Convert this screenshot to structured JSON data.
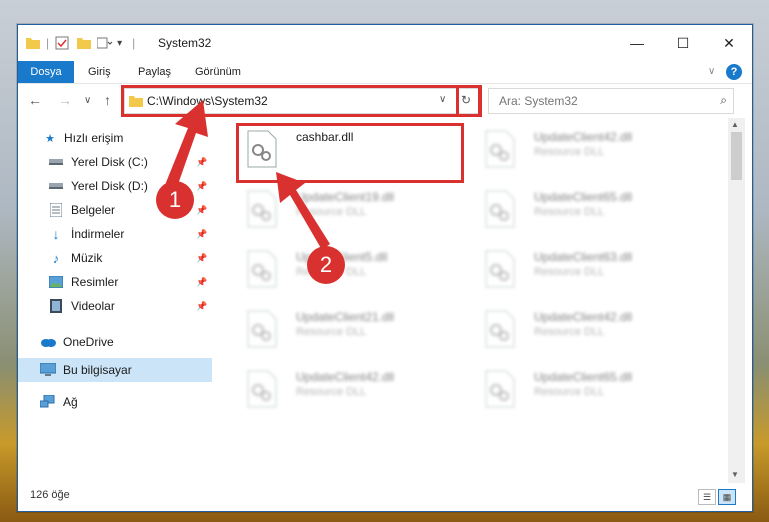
{
  "window": {
    "title": "System32",
    "minimize": "—",
    "maximize": "☐",
    "close": "✕"
  },
  "ribbon": {
    "tabs": [
      "Dosya",
      "Giriş",
      "Paylaş",
      "Görünüm"
    ],
    "collapse": "∨",
    "help": "?"
  },
  "address": {
    "path": "C:\\Windows\\System32",
    "dropdown": "∨",
    "refresh": "↻"
  },
  "nav": {
    "back": "←",
    "forward": "→",
    "recent": "∨",
    "up": "↑"
  },
  "search": {
    "placeholder": "Ara: System32",
    "icon": "⌕"
  },
  "sidebar": {
    "items": [
      {
        "label": "Hızlı erişim",
        "icon": "star-icon"
      },
      {
        "label": "Yerel Disk (C:)",
        "icon": "drive-icon",
        "pinned": true
      },
      {
        "label": "Yerel Disk (D:)",
        "icon": "drive-icon",
        "pinned": true
      },
      {
        "label": "Belgeler",
        "icon": "documents-icon",
        "pinned": true
      },
      {
        "label": "İndirmeler",
        "icon": "downloads-icon",
        "pinned": true
      },
      {
        "label": "Müzik",
        "icon": "music-icon",
        "pinned": true
      },
      {
        "label": "Resimler",
        "icon": "pictures-icon",
        "pinned": true
      },
      {
        "label": "Videolar",
        "icon": "videos-icon",
        "pinned": true
      },
      {
        "label": "OneDrive",
        "icon": "cloud-icon"
      },
      {
        "label": "Bu bilgisayar",
        "icon": "computer-icon",
        "selected": true
      },
      {
        "label": "Ağ",
        "icon": "network-icon"
      }
    ]
  },
  "files": [
    {
      "name": "cashbar.dll",
      "type": ""
    },
    {
      "name": "UpdateClient42.dll",
      "type": "Resource DLL"
    },
    {
      "name": "UpdateClient19.dll",
      "type": "Resource DLL"
    },
    {
      "name": "UpdateClient65.dll",
      "type": "Resource DLL"
    },
    {
      "name": "UpdateClient5.dll",
      "type": "Resource DLL"
    },
    {
      "name": "UpdateClient63.dll",
      "type": "Resource DLL"
    },
    {
      "name": "UpdateClient21.dll",
      "type": "Resource DLL"
    },
    {
      "name": "UpdateClient42.dll",
      "type": "Resource DLL"
    },
    {
      "name": "UpdateClient42.dll",
      "type": "Resource DLL"
    },
    {
      "name": "UpdateClient65.dll",
      "type": "Resource DLL"
    }
  ],
  "status": {
    "count": "126 öğe"
  },
  "callouts": [
    "1",
    "2"
  ],
  "colors": {
    "accent": "#1979ca",
    "highlight": "#d9312f",
    "selection": "#cce4f7"
  }
}
